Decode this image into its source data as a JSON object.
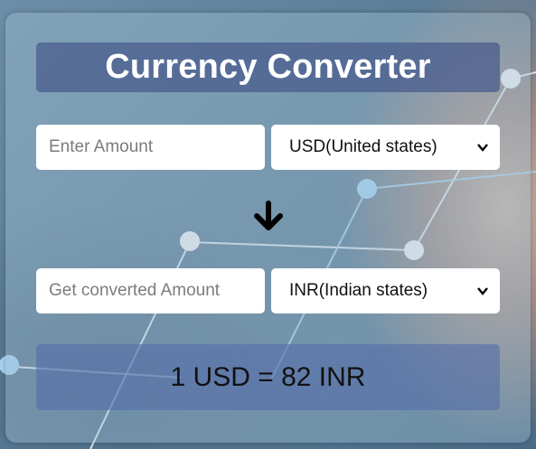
{
  "title": "Currency Converter",
  "amount_input": {
    "placeholder": "Enter Amount",
    "value": ""
  },
  "from_currency": {
    "selected": "USD(United states)"
  },
  "converted_input": {
    "placeholder": "Get converted Amount",
    "value": ""
  },
  "to_currency": {
    "selected": "INR(Indian states)"
  },
  "rate_text": "1 USD = 82 INR",
  "icons": {
    "swap": "arrow-down-icon",
    "dropdown": "chevron-down-icon"
  },
  "colors": {
    "title_bg": "#465a8c",
    "result_bg": "#556eaa",
    "title_text": "#ffffff"
  }
}
